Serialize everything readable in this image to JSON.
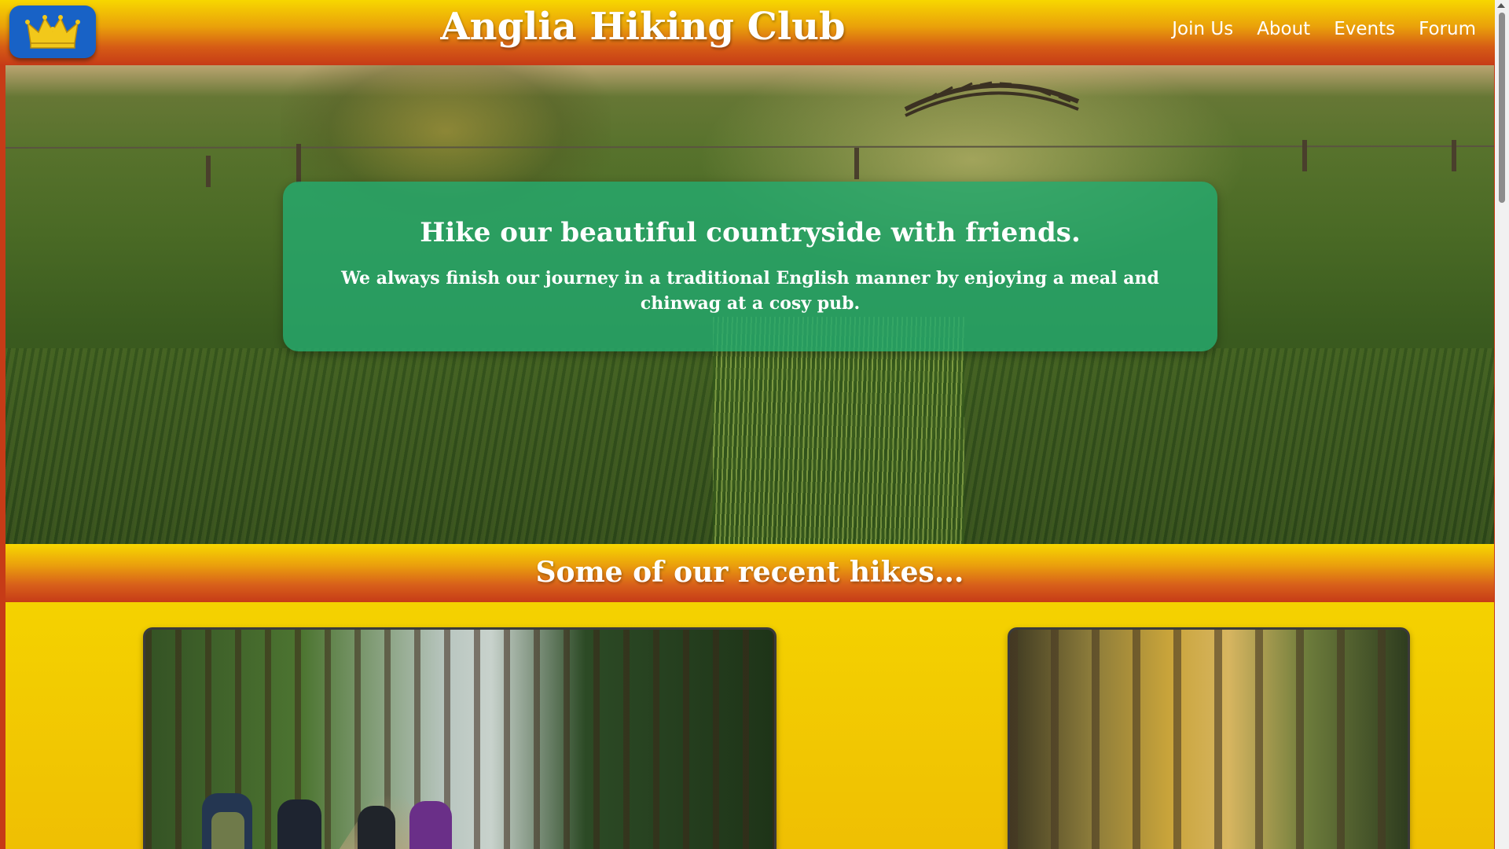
{
  "header": {
    "title": "Anglia Hiking Club",
    "logo_icon": "crown-icon",
    "nav": [
      {
        "label": "Join Us"
      },
      {
        "label": "About"
      },
      {
        "label": "Events"
      },
      {
        "label": "Forum"
      }
    ]
  },
  "hero": {
    "headline": "Hike our beautiful countryside with friends.",
    "subtext": "We always finish our journey in a traditional English manner by enjoying a meal and chinwag at a cosy pub."
  },
  "recent": {
    "heading": "Some of our recent hikes..."
  },
  "colors": {
    "header_top": "#f7d700",
    "header_bottom": "#c63b17",
    "logo_bg": "#1862c6",
    "crown": "#f2c81a",
    "hero_card": "#24aa6e",
    "gallery_bg": "#f4d200"
  }
}
